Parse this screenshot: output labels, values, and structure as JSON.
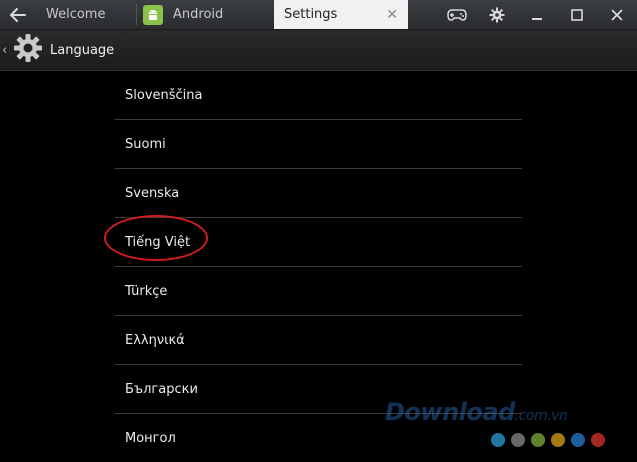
{
  "titlebar": {
    "tabs": [
      {
        "label": "Welcome"
      },
      {
        "label": "Android"
      },
      {
        "label": "Settings"
      }
    ],
    "icons": {
      "back": "arrow-left-icon",
      "android": "android-icon",
      "close_tab": "close-icon",
      "gamepad": "gamepad-icon",
      "gear": "gear-icon",
      "minimize": "minimize-icon",
      "maximize": "maximize-icon",
      "close_window": "close-icon"
    }
  },
  "actionbar": {
    "title": "Language"
  },
  "languages": [
    {
      "label": "Slovenščina"
    },
    {
      "label": "Suomi"
    },
    {
      "label": "Svenska"
    },
    {
      "label": "Tiếng Việt"
    },
    {
      "label": "Türkçe"
    },
    {
      "label": "Ελληνικά"
    },
    {
      "label": "Български"
    },
    {
      "label": "Монгол"
    }
  ],
  "watermark": {
    "main": "Download",
    "suffix": ".com.vn",
    "dot_colors": [
      "#2b9bd6",
      "#8a8a8a",
      "#7fae3a",
      "#d9a21e",
      "#2b7cd6",
      "#d9362b"
    ]
  },
  "colors": {
    "highlight": "#d01c1c",
    "android_green": "#8bc34a"
  }
}
